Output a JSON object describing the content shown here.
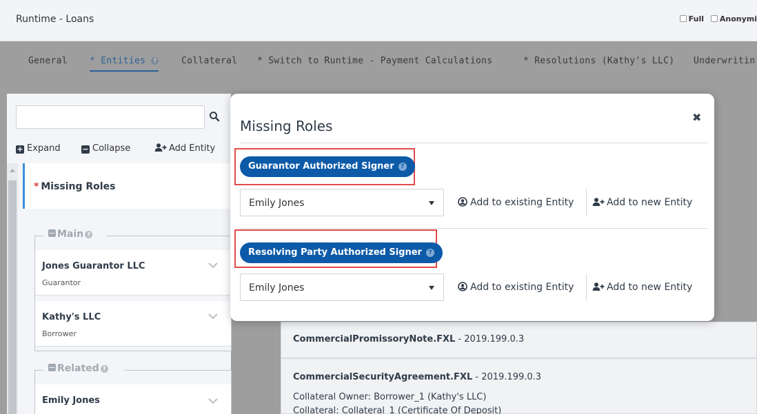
{
  "window": {
    "title": "Runtime - Loans"
  },
  "header_options": [
    {
      "label": "Full"
    },
    {
      "label": "Anonymi"
    }
  ],
  "tabs": [
    {
      "label": "General"
    },
    {
      "label": "* Entities"
    },
    {
      "label": "Collateral"
    },
    {
      "label": "* Switch to Runtime - Payment Calculations"
    },
    {
      "label": "* Resolutions (Kathy's LLC)"
    },
    {
      "label": "Underwritin"
    }
  ],
  "left_panel": {
    "search_placeholder": "",
    "actions": {
      "expand": "Expand",
      "collapse": "Collapse",
      "add_entity": "Add Entity"
    },
    "missing_roles_label": "Missing Roles",
    "groups": [
      {
        "title": "Main",
        "entities": [
          {
            "name": "Jones Guarantor LLC",
            "role": "Guarantor"
          },
          {
            "name": "Kathy's LLC",
            "role": "Borrower"
          }
        ]
      },
      {
        "title": "Related",
        "entities": [
          {
            "name": "Emily Jones",
            "role": ""
          }
        ]
      }
    ]
  },
  "documents": [
    {
      "name": "CommercialPromissoryNote.FXL",
      "version": " - 2019.199.0.3",
      "details": []
    },
    {
      "name": "CommercialSecurityAgreement.FXL",
      "version": " - 2019.199.0.3",
      "details": [
        "Collateral Owner: Borrower_1 (Kathy's LLC)",
        "Collateral: Collateral_1 (Certificate Of Deposit)"
      ]
    }
  ],
  "modal": {
    "title": "Missing Roles",
    "close_symbol": "✖",
    "roles": [
      {
        "label": "Guarantor Authorized Signer",
        "selected": "Emily Jones",
        "add_existing": "Add to existing Entity",
        "add_new": "Add to new Entity"
      },
      {
        "label": "Resolving Party Authorized Signer",
        "selected": "Emily Jones",
        "add_existing": "Add to existing Entity",
        "add_new": "Add to new Entity"
      }
    ]
  },
  "colors": {
    "accent": "#0c5aa8",
    "highlight_box": "#e04a4a",
    "active_tab": "#2d5f97"
  }
}
